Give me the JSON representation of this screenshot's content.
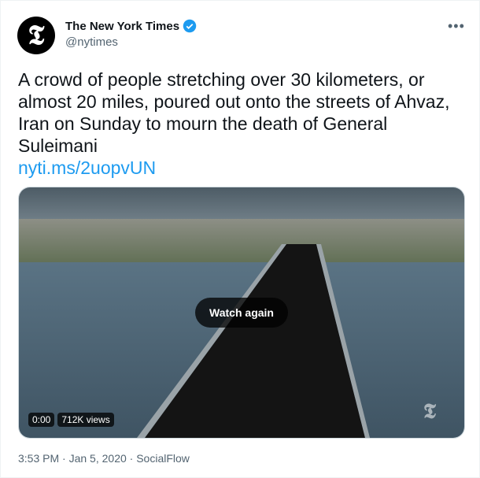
{
  "tweet": {
    "author_name": "The New York Times",
    "handle": "@nytimes",
    "avatar_glyph": "𝕿",
    "text": "A crowd of people stretching over 30 kilometers, or almost 20 miles, poured out onto the streets of Ahvaz, Iran on Sunday to mourn the death of General Suleimani",
    "link": "nyti.ms/2uopvUN",
    "more_icon": "more-horizontal-icon",
    "verified_icon": "verified-badge-icon",
    "accent_color": "#1d9bf0"
  },
  "video": {
    "watch_again_label": "Watch again",
    "time": "0:00",
    "views": "712K views",
    "watermark": "𝕿"
  },
  "meta": {
    "time": "3:53 PM",
    "date": "Jan 5, 2020",
    "source": "SocialFlow",
    "separator": "·"
  }
}
